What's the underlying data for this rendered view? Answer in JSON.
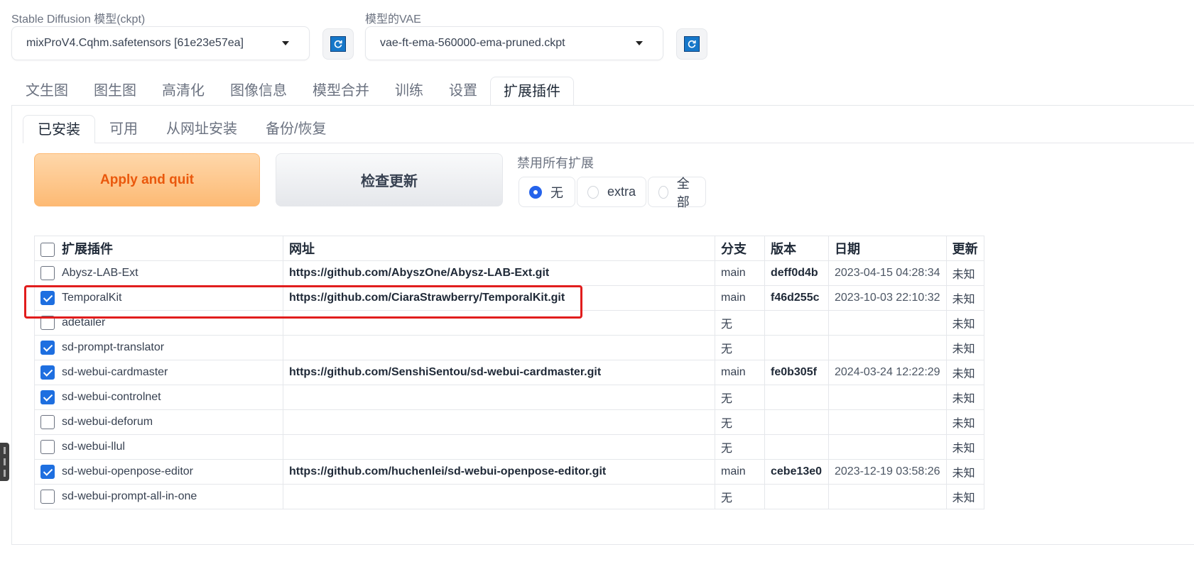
{
  "model": {
    "label": "Stable Diffusion 模型(ckpt)",
    "value": "mixProV4.Cqhm.safetensors [61e23e57ea]"
  },
  "vae": {
    "label": "模型的VAE",
    "value": "vae-ft-ema-560000-ema-pruned.ckpt"
  },
  "tabs": [
    "文生图",
    "图生图",
    "高清化",
    "图像信息",
    "模型合并",
    "训练",
    "设置",
    "扩展插件"
  ],
  "subtabs": [
    "已安装",
    "可用",
    "从网址安装",
    "备份/恢复"
  ],
  "buttons": {
    "apply": "Apply and quit",
    "check": "检查更新"
  },
  "disable": {
    "label": "禁用所有扩展",
    "options": [
      "无",
      "extra",
      "全部"
    ],
    "selected": "无"
  },
  "table": {
    "headers": [
      "扩展插件",
      "网址",
      "分支",
      "版本",
      "日期",
      "更新"
    ],
    "rows": [
      {
        "name": "Abysz-LAB-Ext",
        "checked": false,
        "url": "https://github.com/AbyszOne/Abysz-LAB-Ext.git",
        "branch": "main",
        "version": "deff0d4b",
        "date": "2023-04-15 04:28:34",
        "update": "未知"
      },
      {
        "name": "TemporalKit",
        "checked": true,
        "url": "https://github.com/CiaraStrawberry/TemporalKit.git",
        "branch": "main",
        "version": "f46d255c",
        "date": "2023-10-03 22:10:32",
        "update": "未知"
      },
      {
        "name": "adetailer",
        "checked": false,
        "url": "",
        "branch": "无",
        "version": "",
        "date": "",
        "update": "未知"
      },
      {
        "name": "sd-prompt-translator",
        "checked": true,
        "url": "",
        "branch": "无",
        "version": "",
        "date": "",
        "update": "未知"
      },
      {
        "name": "sd-webui-cardmaster",
        "checked": true,
        "url": "https://github.com/SenshiSentou/sd-webui-cardmaster.git",
        "branch": "main",
        "version": "fe0b305f",
        "date": "2024-03-24 12:22:29",
        "update": "未知"
      },
      {
        "name": "sd-webui-controlnet",
        "checked": true,
        "url": "",
        "branch": "无",
        "version": "",
        "date": "",
        "update": "未知"
      },
      {
        "name": "sd-webui-deforum",
        "checked": false,
        "url": "",
        "branch": "无",
        "version": "",
        "date": "",
        "update": "未知"
      },
      {
        "name": "sd-webui-llul",
        "checked": false,
        "url": "",
        "branch": "无",
        "version": "",
        "date": "",
        "update": "未知"
      },
      {
        "name": "sd-webui-openpose-editor",
        "checked": true,
        "url": "https://github.com/huchenlei/sd-webui-openpose-editor.git",
        "branch": "main",
        "version": "cebe13e0",
        "date": "2023-12-19 03:58:26",
        "update": "未知"
      },
      {
        "name": "sd-webui-prompt-all-in-one",
        "checked": false,
        "url": "",
        "branch": "无",
        "version": "",
        "date": "",
        "update": "未知"
      }
    ]
  }
}
